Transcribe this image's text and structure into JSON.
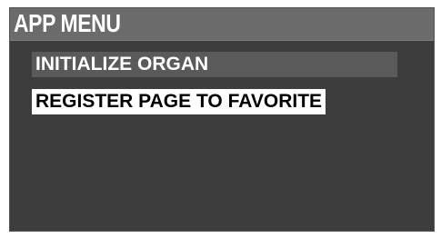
{
  "window": {
    "title": "APP MENU"
  },
  "menu": {
    "items": [
      {
        "label": "INITIALIZE ORGAN",
        "selected": false
      },
      {
        "label": "REGISTER PAGE TO FAVORITE",
        "selected": true
      }
    ]
  },
  "colors": {
    "screen_background": "#3d3d3d",
    "title_bar": "#6b6b6b",
    "item_background": "#5a5a5a",
    "selected_background": "#ffffff",
    "selected_text": "#000000",
    "text": "#ffffff"
  }
}
